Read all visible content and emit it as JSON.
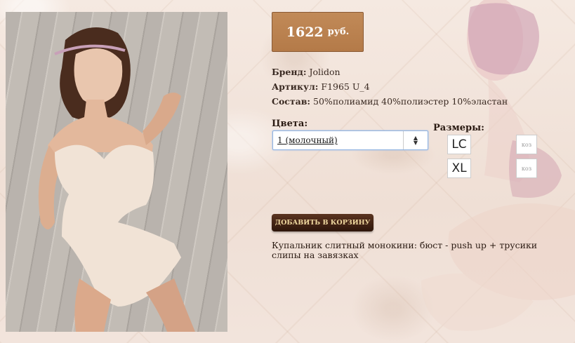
{
  "price": {
    "amount": "1622",
    "currency": "руб."
  },
  "specs": {
    "brand_label": "Бренд:",
    "brand": "Jolidon",
    "article_label": "Артикул:",
    "article": "F1965 U_4",
    "composition_label": "Состав:",
    "composition": "50%полиамид 40%полиэстер 10%эластан"
  },
  "colors": {
    "label": "Цвета:",
    "selected": "1 (молочный)"
  },
  "sizes": {
    "label": "Размеры:",
    "items": [
      "LC",
      "XL"
    ],
    "thumb_text": "коз"
  },
  "cart_button": "ДОБАВИТЬ В КОРЗИНУ",
  "description": "Купальник слитный монокини: бюст - push up + трусики слипы на завязках"
}
